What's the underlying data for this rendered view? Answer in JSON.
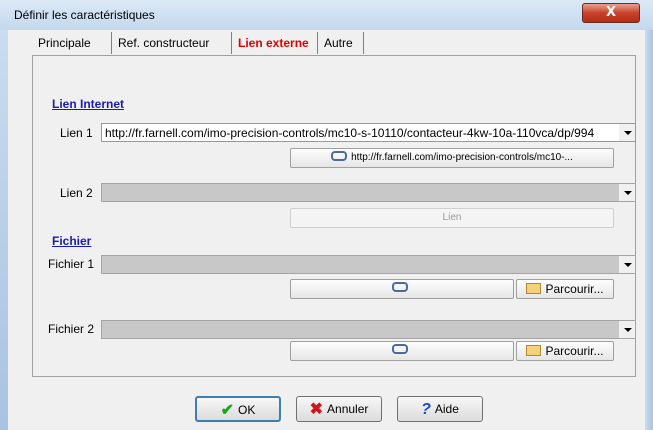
{
  "window": {
    "title": "Définir les caractéristiques",
    "close_label": "X"
  },
  "tabs": [
    {
      "label": "Principale"
    },
    {
      "label": "Ref. constructeur"
    },
    {
      "label": "Lien externe",
      "active": true
    },
    {
      "label": "Autre"
    }
  ],
  "internet": {
    "title": "Lien Internet",
    "lien1": {
      "label": "Lien 1",
      "value": "http://fr.farnell.com/imo-precision-controls/mc10-s-10110/contacteur-4kw-10a-110vca/dp/994",
      "button": "http://fr.farnell.com/imo-precision-controls/mc10-..."
    },
    "lien2": {
      "label": "Lien 2",
      "value": "",
      "button": "Lien"
    }
  },
  "fichier": {
    "title": "Fichier",
    "fichier1": {
      "label": "Fichier 1",
      "value": "",
      "browse": "Parcourir..."
    },
    "fichier2": {
      "label": "Fichier 2",
      "value": "",
      "browse": "Parcourir..."
    }
  },
  "footer": {
    "ok": "OK",
    "annuler": "Annuler",
    "aide": "Aide"
  },
  "icons": {
    "link": "link-icon",
    "folder": "folder-icon",
    "check": "check-icon",
    "cancel": "cancel-x-icon",
    "help": "help-question-icon"
  }
}
